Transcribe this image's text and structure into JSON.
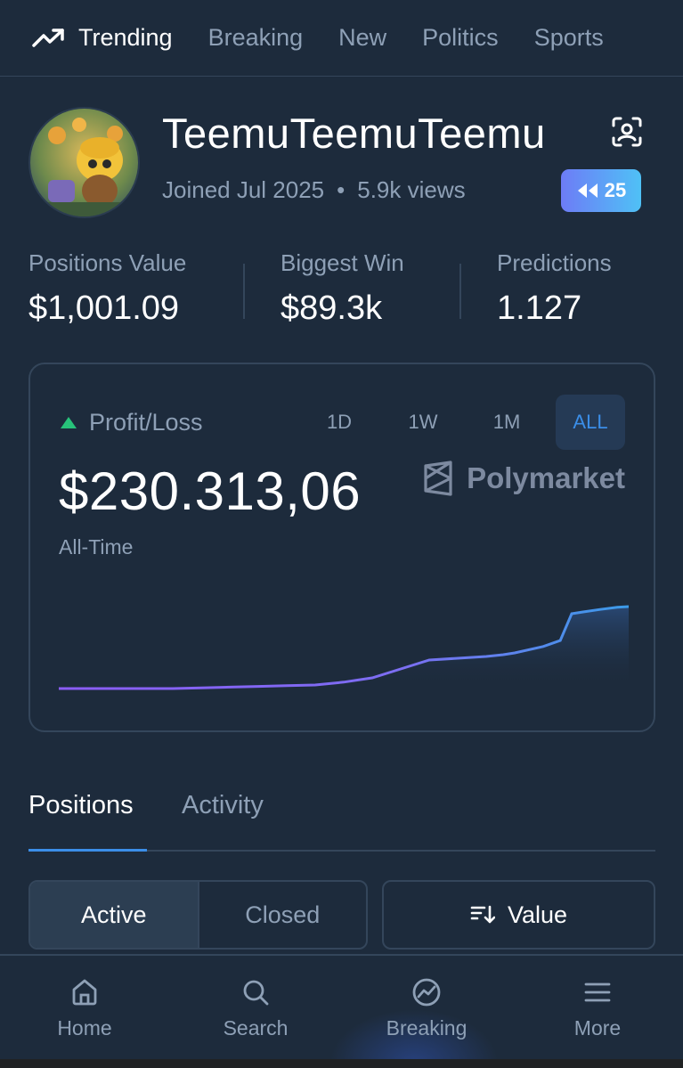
{
  "topnav": {
    "items": [
      {
        "label": "Trending",
        "active": true
      },
      {
        "label": "Breaking"
      },
      {
        "label": "New"
      },
      {
        "label": "Politics"
      },
      {
        "label": "Sports"
      }
    ]
  },
  "profile": {
    "username": "TeemuTeemuTeemu",
    "joined": "Joined Jul 2025",
    "views": "5.9k views",
    "badge_count": "25"
  },
  "stats": [
    {
      "label": "Positions Value",
      "value": "$1,001.09"
    },
    {
      "label": "Biggest Win",
      "value": "$89.3k"
    },
    {
      "label": "Predictions",
      "value": "1.127"
    }
  ],
  "pnl": {
    "label": "Profit/Loss",
    "ranges": [
      "1D",
      "1W",
      "1M",
      "ALL"
    ],
    "active_range": "ALL",
    "value": "$230.313,06",
    "brand": "Polymarket",
    "period": "All-Time",
    "colors": {
      "positive": "#27c27a",
      "line_start": "#8b5cf6",
      "line_end": "#3b9be8"
    }
  },
  "chart_data": {
    "type": "line",
    "x": [
      0,
      5,
      10,
      15,
      20,
      25,
      30,
      35,
      40,
      45,
      50,
      55,
      60,
      65,
      70,
      75,
      78,
      80,
      85,
      88,
      90,
      92,
      95,
      98,
      100
    ],
    "values": [
      0,
      0,
      0,
      0,
      0,
      2,
      4,
      6,
      8,
      10,
      18,
      30,
      55,
      80,
      85,
      90,
      95,
      100,
      118,
      135,
      210,
      215,
      222,
      228,
      230
    ],
    "ylabel": "",
    "xlabel": ""
  },
  "tabs": [
    {
      "label": "Positions",
      "active": true
    },
    {
      "label": "Activity"
    }
  ],
  "filters": {
    "status_options": [
      "Active",
      "Closed"
    ],
    "active_status": "Active",
    "sort_label": "Value"
  },
  "bottomnav": {
    "items": [
      {
        "label": "Home",
        "icon": "home-icon"
      },
      {
        "label": "Search",
        "icon": "search-icon"
      },
      {
        "label": "Breaking",
        "icon": "trend-circle-icon"
      },
      {
        "label": "More",
        "icon": "menu-icon"
      }
    ]
  }
}
